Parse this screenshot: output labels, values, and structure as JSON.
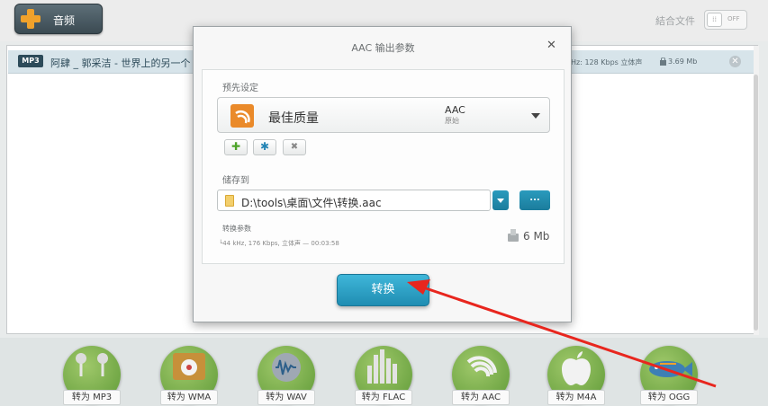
{
  "toolbar": {
    "add_label": "音频",
    "merge_label": "結合文件",
    "merge_state": "OFF"
  },
  "file": {
    "format": "MP3",
    "name": "阿肆 _ 郭采洁 - 世界上的另一个",
    "info": "Hz: 128 Kbps 立体声",
    "size": "3.69 Mb"
  },
  "dialog": {
    "title": "AAC 输出参数",
    "preset_section": "预先设定",
    "preset_name": "最佳质量",
    "preset_codec": "AAC",
    "preset_sub": "原始",
    "save_section": "储存到",
    "path": "D:\\tools\\桌面\\文件\\转换.aac",
    "browse_label": "...",
    "params_title": "转换参数",
    "params_detail": "44 kHz, 176 Kbps, 立体声 — 00:03:58",
    "size": "6 Mb",
    "convert_label": "转换"
  },
  "formats": [
    {
      "label": "转为 MP3",
      "icon": "earphones-icon"
    },
    {
      "label": "转为 WMA",
      "icon": "media-player-icon"
    },
    {
      "label": "转为 WAV",
      "icon": "waveform-icon"
    },
    {
      "label": "转为 FLAC",
      "icon": "equalizer-icon"
    },
    {
      "label": "转为 AAC",
      "icon": "aac-logo-icon"
    },
    {
      "label": "转为 M4A",
      "icon": "apple-icon"
    },
    {
      "label": "转为 OGG",
      "icon": "fish-icon"
    }
  ],
  "colors": {
    "accent": "#1f8db2",
    "format_green": "#6aa43f",
    "annotation_red": "#e8261e"
  }
}
